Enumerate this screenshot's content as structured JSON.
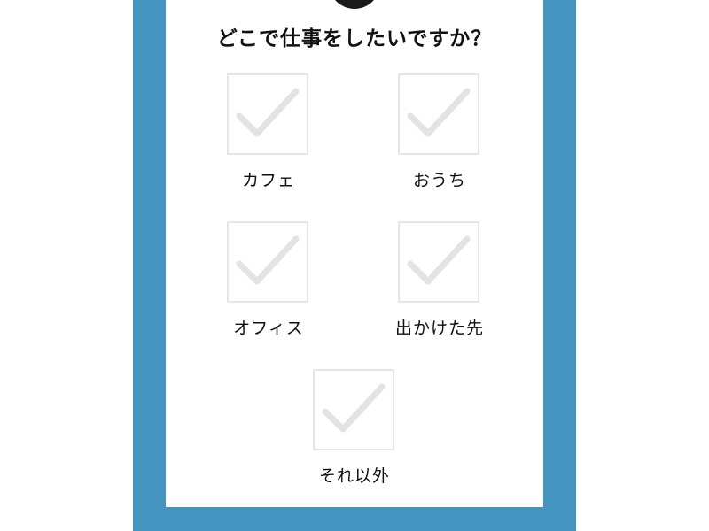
{
  "question": "どこで仕事をしたいですか？",
  "colors": {
    "frame": "#4593bf",
    "card": "#ffffff",
    "check_mark": "#e3e3e3",
    "checkbox_border": "#e6e6e6",
    "top_circle": "#1a1a1a"
  },
  "options": [
    {
      "label": "カフェ",
      "icon": "check-icon",
      "checked": false
    },
    {
      "label": "おうち",
      "icon": "check-icon",
      "checked": false
    },
    {
      "label": "オフィス",
      "icon": "check-icon",
      "checked": false
    },
    {
      "label": "出かけた先",
      "icon": "check-icon",
      "checked": false
    },
    {
      "label": "それ以外",
      "icon": "check-icon",
      "checked": false
    }
  ]
}
